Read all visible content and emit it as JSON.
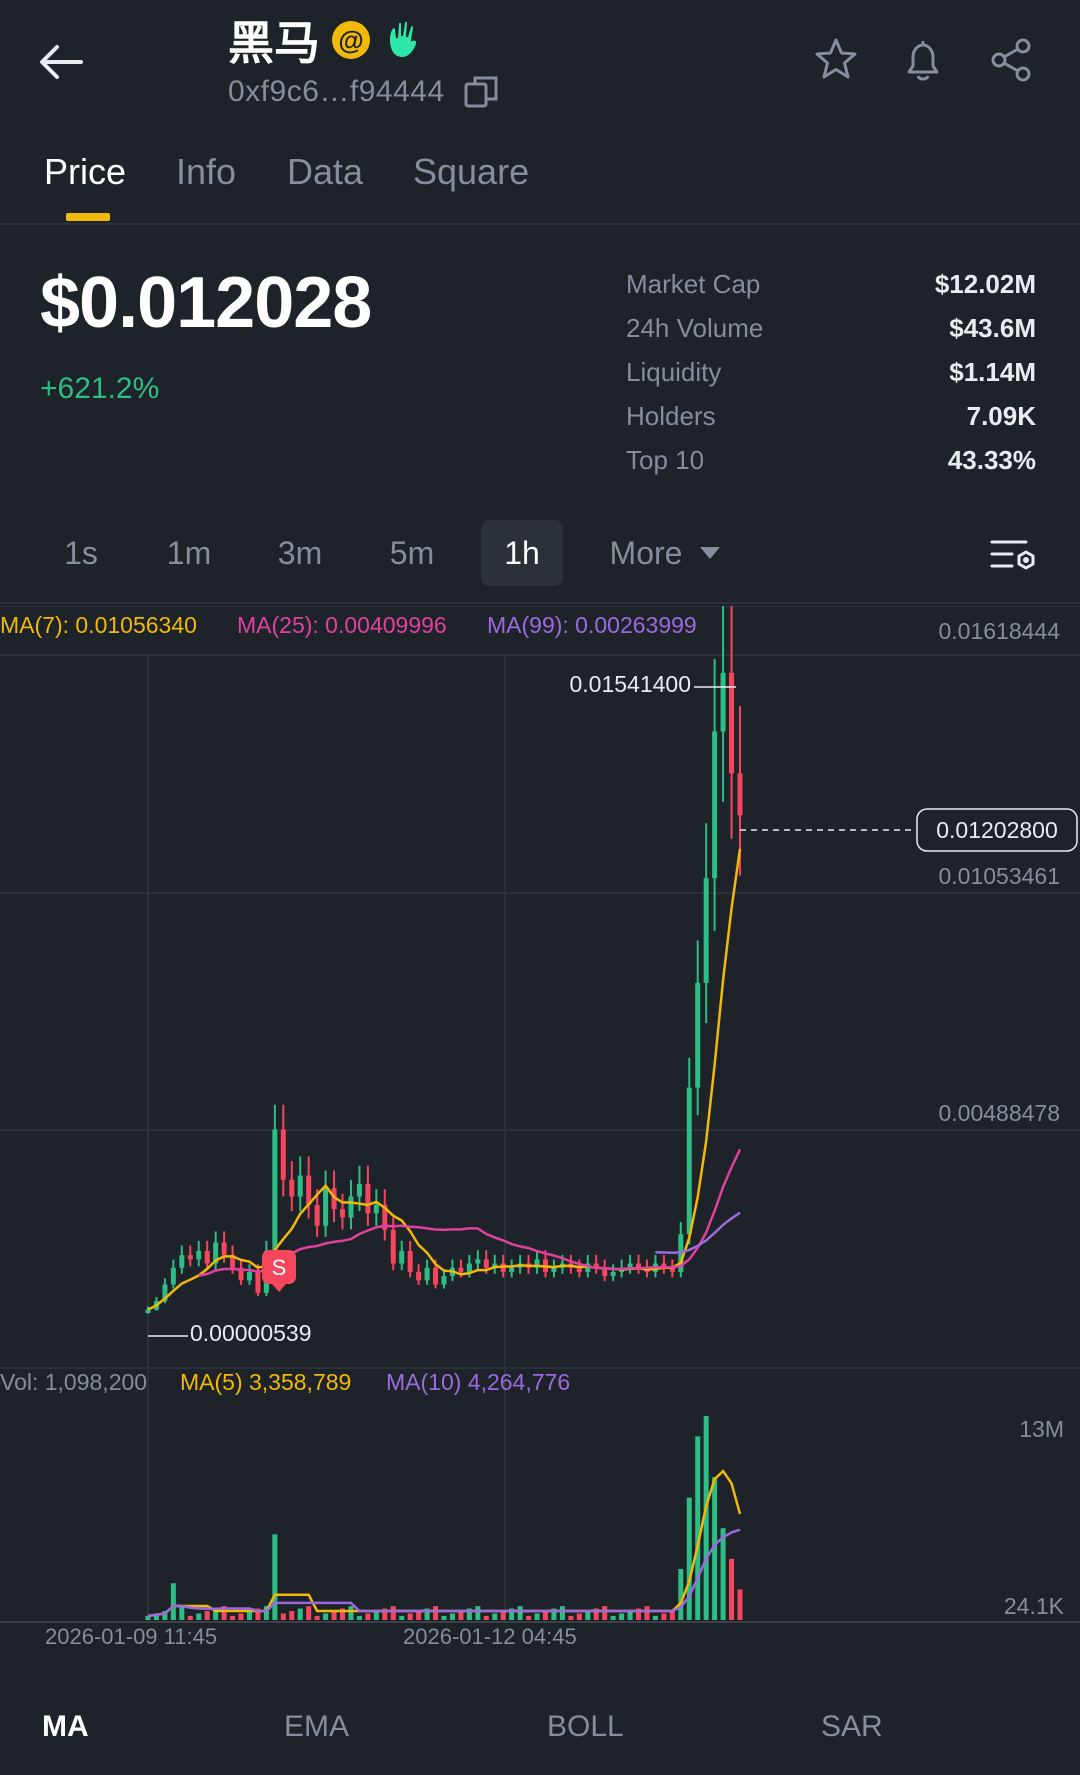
{
  "header": {
    "token_name": "黑马",
    "badge_at": "@",
    "address": "0xf9c6…f94444"
  },
  "tabs": [
    "Price",
    "Info",
    "Data",
    "Square"
  ],
  "price": {
    "value": "$0.012028",
    "change": "+621.2%"
  },
  "stats": [
    {
      "label": "Market Cap",
      "value": "$12.02M"
    },
    {
      "label": "24h Volume",
      "value": "$43.6M"
    },
    {
      "label": "Liquidity",
      "value": "$1.14M"
    },
    {
      "label": "Holders",
      "value": "7.09K"
    },
    {
      "label": "Top 10",
      "value": "43.33%"
    }
  ],
  "intervals": [
    "1s",
    "1m",
    "3m",
    "5m",
    "1h",
    "More"
  ],
  "selected_interval": "1h",
  "chart": {
    "ma_legend": [
      {
        "text": "MA(7): 0.01056340",
        "color": "#f0b90b"
      },
      {
        "text": "MA(25): 0.00409996",
        "color": "#e040a0"
      },
      {
        "text": "MA(99): 0.00263999",
        "color": "#9c6ade"
      }
    ],
    "price_axis": [
      "0.01618444",
      "0.01053461",
      "0.00488478"
    ],
    "high_label": "0.01541400",
    "low_label": "0.00000539",
    "current_price_label": "0.01202800",
    "sell_marker": "S",
    "vol_legend": [
      {
        "text": "Vol: 1,098,200",
        "color": "#848e9c"
      },
      {
        "text": "MA(5) 3,358,789",
        "color": "#f0b90b"
      },
      {
        "text": "MA(10) 4,264,776",
        "color": "#9c6ade"
      }
    ],
    "vol_axis": [
      "13M",
      "24.1K"
    ],
    "time_labels": [
      "2026-01-09 11:45",
      "2026-01-12 04:45"
    ]
  },
  "chart_data": {
    "type": "candlestick",
    "title": "",
    "ylim": [
      0,
      0.01618444
    ],
    "time_ticks": [
      "2026-01-09 11:45",
      "2026-01-12 04:45"
    ],
    "high": 0.015414,
    "low": 5.39e-06,
    "last": 0.012028,
    "candles_close": [
      0.0002,
      0.0004,
      0.0008,
      0.0012,
      0.0015,
      0.0014,
      0.0016,
      0.0013,
      0.0018,
      0.0015,
      0.0012,
      0.0009,
      0.0011,
      0.0006,
      0.0016,
      0.0045,
      0.0033,
      0.0029,
      0.0034,
      0.0027,
      0.0022,
      0.0031,
      0.0026,
      0.0024,
      0.0029,
      0.0032,
      0.0025,
      0.0027,
      0.0021,
      0.0013,
      0.0016,
      0.0011,
      0.0009,
      0.0012,
      0.0008,
      0.001,
      0.0012,
      0.0011,
      0.0013,
      0.0014,
      0.0012,
      0.0013,
      0.0011,
      0.0012,
      0.0013,
      0.0012,
      0.0014,
      0.0011,
      0.0012,
      0.0013,
      0.0012,
      0.0011,
      0.0013,
      0.0012,
      0.001,
      0.0011,
      0.0012,
      0.0013,
      0.0012,
      0.0011,
      0.0013,
      0.0012,
      0.0011,
      0.002,
      0.0055,
      0.008,
      0.0105,
      0.014,
      0.0154,
      0.013,
      0.012
    ],
    "ma7_last": 0.0105634,
    "ma25_last": 0.00409996,
    "ma99_last": 0.00263999,
    "volume_axis": [
      "24.1K",
      "13M"
    ],
    "volume_last": 1098200,
    "vol_ma5_last": 3358789,
    "vol_ma10_last": 4264776
  },
  "indicators": [
    "MA",
    "EMA",
    "BOLL",
    "SAR"
  ],
  "selected_indicator": "MA",
  "colors": {
    "up": "#2ebd85",
    "down": "#f6465d",
    "accent": "#f0b90b",
    "bg": "#1e2329"
  }
}
